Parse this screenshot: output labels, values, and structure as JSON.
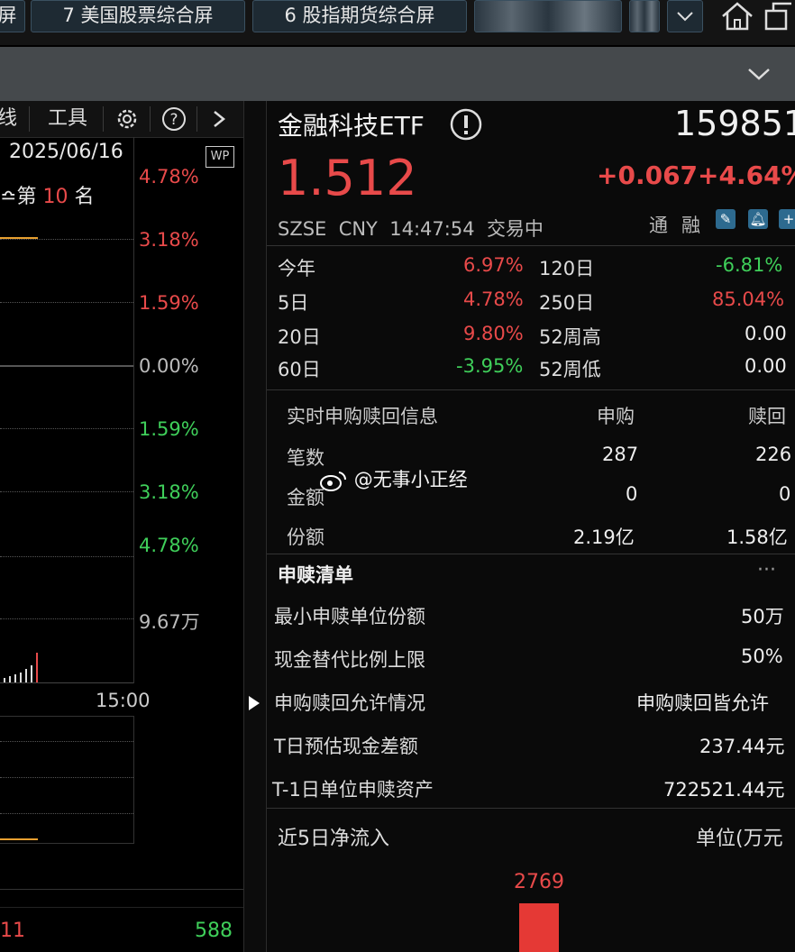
{
  "tabs": [
    {
      "label": "屏"
    },
    {
      "label": "7 美国股票综合屏"
    },
    {
      "label": "6 股指期货综合屏"
    }
  ],
  "toolbar": {
    "line_label": "线",
    "tools_label": "工具",
    "settings_icon": "gear-icon",
    "help_icon": "help-icon",
    "next_icon": "chevron-right-icon"
  },
  "chart": {
    "date": "2025/06/16",
    "wp_label": "WP",
    "rank_prefix": "第",
    "rank_value": "10",
    "rank_suffix": "名",
    "time_label": "15:00",
    "bottom_left": "11",
    "bottom_right": "588"
  },
  "chart_data": {
    "type": "line",
    "pct_ticks_right": [
      "4.78%",
      "3.18%",
      "1.59%",
      "0.00%",
      "1.59%",
      "3.18%",
      "4.78%"
    ],
    "volume_max_label": "9.67万",
    "x_labels": [
      "15:00"
    ]
  },
  "quote": {
    "name": "金融科技ETF",
    "code": "159851",
    "price": "1.512",
    "change": "+0.067",
    "change_pct": "+4.64%",
    "exchange": "SZSE",
    "currency": "CNY",
    "time": "14:47:54",
    "status": "交易中",
    "tag1": "通",
    "tag2": "融",
    "colors": {
      "up": "#e84a4a",
      "down": "#3fcf5a"
    }
  },
  "stats": [
    {
      "label": "今年",
      "value": "6.97%",
      "label2": "120日",
      "value2": "-6.81%"
    },
    {
      "label": "5日",
      "value": "4.78%",
      "label2": "250日",
      "value2": "85.04%"
    },
    {
      "label": "20日",
      "value": "9.80%",
      "label2": "52周高",
      "value2": "0.00"
    },
    {
      "label": "60日",
      "value": "-3.95%",
      "label2": "52周低",
      "value2": "0.00"
    }
  ],
  "realtime": {
    "title": "实时申购赎回信息",
    "col_sub": "申购",
    "col_red": "赎回",
    "rows": [
      {
        "label": "笔数",
        "sub": "287",
        "red": "226"
      },
      {
        "label": "金额",
        "sub": "0",
        "red": "0"
      },
      {
        "label": "份额",
        "sub": "2.19亿",
        "red": "1.58亿"
      }
    ],
    "watermark": "@无事小正经"
  },
  "list": {
    "title": "申赎清单",
    "more": "···",
    "items": [
      {
        "label": "最小申赎单位份额",
        "value": "50万"
      },
      {
        "label": "现金替代比例上限",
        "value": "50%"
      },
      {
        "label": "申购赎回允许情况",
        "value": "申购赎回皆允许"
      },
      {
        "label": "T日预估现金差额",
        "value": "237.44元"
      },
      {
        "label": "T-1日单位申赎资产",
        "value": "722521.44元"
      }
    ]
  },
  "flow": {
    "title": "近5日净流入",
    "unit": "单位(万元",
    "bar_value": "2769"
  }
}
